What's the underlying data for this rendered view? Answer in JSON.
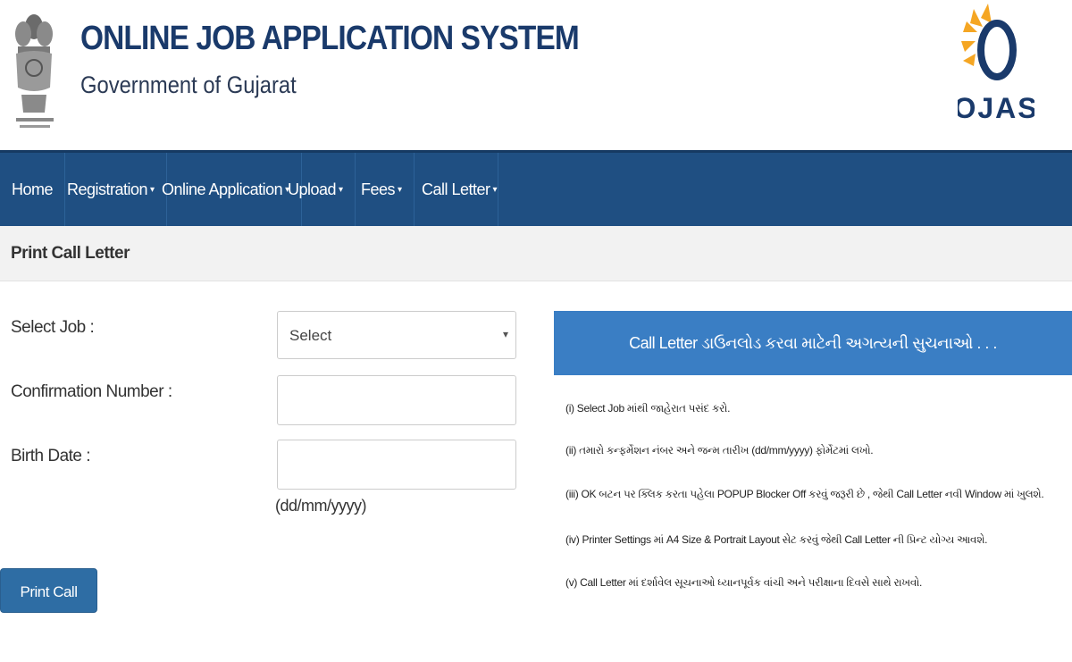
{
  "header": {
    "title": "ONLINE JOB APPLICATION SYSTEM",
    "subtitle": "Government of Gujarat",
    "emblem_icon": "state-emblem-icon",
    "logo_text": "OJAS"
  },
  "nav": {
    "items": [
      {
        "label": "Home",
        "dropdown": false
      },
      {
        "label": "Registration",
        "dropdown": true
      },
      {
        "label": "Online Application",
        "dropdown": true
      },
      {
        "label": "Upload",
        "dropdown": true
      },
      {
        "label": "Fees",
        "dropdown": true
      },
      {
        "label": "Call Letter",
        "dropdown": true
      }
    ],
    "caret": "▾"
  },
  "page": {
    "heading": "Print Call Letter"
  },
  "form": {
    "select_job_label": "Select Job :",
    "select_job_value": "Select",
    "confirmation_label": "Confirmation Number :",
    "confirmation_value": "",
    "birth_date_label": "Birth Date :",
    "birth_date_value": "",
    "birth_date_hint": "(dd/mm/yyyy)",
    "print_button": "Print Call Letter"
  },
  "instructions": {
    "heading": "Call Letter ડાઉનલોડ કરવા માટેની અગત્યની સુચનાઓ . . .",
    "items": [
      "(i) Select Job માંથી જાહેરાત પસંદ કરો.",
      "(ii) તમારો કન્ફર્મેશન નંબર અને જન્મ તારીખ (dd/mm/yyyy) ફોર્મેટમાં લખો.",
      "(iii) OK બટન પર ક્લિક કરતા પહેલા POPUP Blocker Off કરવું જરૂરી છે , જેથી Call Letter નવી Window માં ખુલશે.",
      "(iv) Printer Settings માં A4 Size & Portrait Layout સેટ કરવું જેથી Call Letter ની પ્રિન્ટ યોગ્ય આવશે.",
      "(v) Call Letter માં દર્શાવેલ સૂચનાઓ ધ્યાનપૂર્વક વાંચી અને પરીક્ષાના દિવસે સાથે રાખવો."
    ]
  },
  "colors": {
    "nav_bg": "#1f4f82",
    "panel_head_bg": "#3a7ec4",
    "button_bg": "#2e6da4",
    "title_color": "#1a3a6b"
  }
}
